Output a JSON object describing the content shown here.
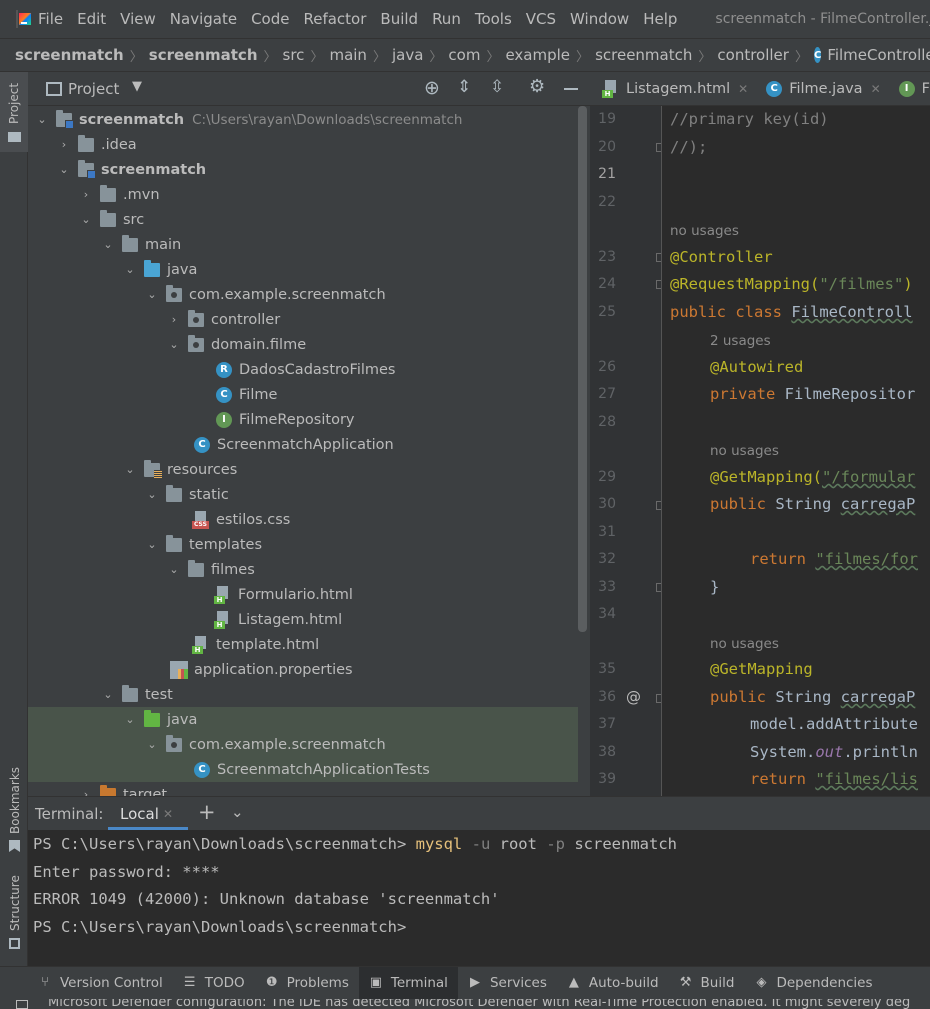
{
  "menu": {
    "items": [
      "File",
      "Edit",
      "View",
      "Navigate",
      "Code",
      "Refactor",
      "Build",
      "Run",
      "Tools",
      "VCS",
      "Window",
      "Help"
    ],
    "window_title": "screenmatch - FilmeController.java"
  },
  "breadcrumb": {
    "items": [
      "screenmatch",
      "screenmatch",
      "src",
      "main",
      "java",
      "com",
      "example",
      "screenmatch",
      "controller"
    ],
    "current": "FilmeController"
  },
  "left_strip": {
    "project": "Project",
    "bookmarks": "Bookmarks",
    "structure": "Structure"
  },
  "project_panel": {
    "title": "Project",
    "root_path": "C:\\Users\\rayan\\Downloads\\screenmatch",
    "tree": [
      "screenmatch",
      ".idea",
      "screenmatch",
      ".mvn",
      "src",
      "main",
      "java",
      "com.example.screenmatch",
      "controller",
      "domain.filme",
      "DadosCadastroFilmes",
      "Filme",
      "FilmeRepository",
      "ScreenmatchApplication",
      "resources",
      "static",
      "estilos.css",
      "templates",
      "filmes",
      "Formulario.html",
      "Listagem.html",
      "template.html",
      "application.properties",
      "test",
      "java",
      "com.example.screenmatch",
      "ScreenmatchApplicationTests",
      "target"
    ]
  },
  "editor": {
    "tabs": [
      "Listagem.html",
      "Filme.java",
      "Filr"
    ],
    "line_numbers": [
      "19",
      "20",
      "21",
      "22",
      "23",
      "24",
      "25",
      "26",
      "27",
      "28",
      "29",
      "30",
      "31",
      "32",
      "33",
      "34",
      "35",
      "36",
      "37",
      "38",
      "39"
    ],
    "hints": [
      "no usages",
      "2 usages",
      "no usages",
      "no usages"
    ],
    "gutter_at": "@",
    "code": {
      "l19": "//primary key(id)",
      "l20": "//);",
      "l23": "@Controller",
      "l24a": "@RequestMapping(",
      "l24b": "\"/filmes\"",
      "l24c": ")",
      "l25a": "public class ",
      "l25b": "FilmeControll",
      "l26": "@Autowired",
      "l27a": "private ",
      "l27b": "FilmeRepositor",
      "l29a": "@GetMapping(",
      "l29b": "\"/formular",
      "l30a": "public ",
      "l30b": "String ",
      "l30c": "carregaP",
      "l32a": "return ",
      "l32b": "\"filmes/for",
      "l33": "}",
      "l35": "@GetMapping",
      "l36a": "public ",
      "l36b": "String ",
      "l36c": "carregaP",
      "l37": "model.addAttribute",
      "l38a": "System.",
      "l38b": "out",
      "l38c": ".println",
      "l39a": "return ",
      "l39b": "\"filmes/lis"
    }
  },
  "terminal": {
    "label": "Terminal:",
    "tab": "Local",
    "prompt1": "PS C:\\Users\\rayan\\Downloads\\screenmatch> ",
    "cmd": "mysql",
    "opt_u": "-u",
    "user": "root",
    "opt_p": "-p",
    "db": "screenmatch",
    "line2": "Enter password: ****",
    "line3": "ERROR 1049 (42000): Unknown database 'screenmatch'",
    "prompt2": "PS C:\\Users\\rayan\\Downloads\\screenmatch>"
  },
  "toolwindows": [
    "Version Control",
    "TODO",
    "Problems",
    "Terminal",
    "Services",
    "Auto-build",
    "Build",
    "Dependencies"
  ],
  "status": "Microsoft Defender configuration: The IDE has detected Microsoft Defender with Real-Time Protection enabled. It might severely deg"
}
